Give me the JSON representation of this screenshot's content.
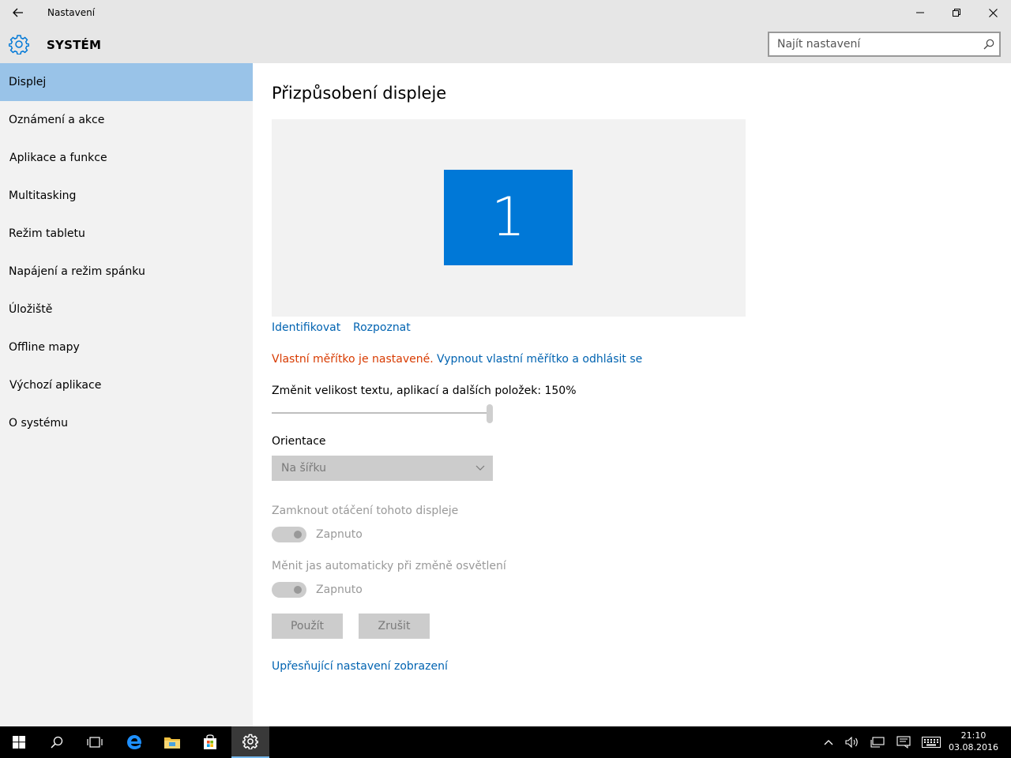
{
  "window": {
    "title": "Nastavení",
    "controls": [
      "minimize",
      "restore",
      "close"
    ]
  },
  "header": {
    "section_title": "SYSTÉM",
    "search_placeholder": "Najít nastavení"
  },
  "sidebar": {
    "items": [
      {
        "label": "Displej",
        "active": true
      },
      {
        "label": "Oznámení a akce"
      },
      {
        "label": "Aplikace a funkce"
      },
      {
        "label": "Multitasking"
      },
      {
        "label": "Režim tabletu"
      },
      {
        "label": "Napájení a režim spánku"
      },
      {
        "label": "Úložiště"
      },
      {
        "label": "Offline mapy"
      },
      {
        "label": "Výchozí aplikace"
      },
      {
        "label": "O systému"
      }
    ]
  },
  "main": {
    "title": "Přizpůsobení displeje",
    "monitor_number": "1",
    "identify_link": "Identifikovat",
    "detect_link": "Rozpoznat",
    "custom_scale_warning": "Vlastní měřítko je nastavené.",
    "disable_custom_scale_link": "Vypnout vlastní měřítko a odhlásit se",
    "scale_label": "Změnit velikost textu, aplikací a dalších položek: 150%",
    "scale_value_percent": 100,
    "orientation_label": "Orientace",
    "orientation_value": "Na šířku",
    "rotation_lock_label": "Zamknout otáčení tohoto displeje",
    "rotation_lock_state": "Zapnuto",
    "auto_brightness_label": "Měnit jas automaticky při změně osvětlení",
    "auto_brightness_state": "Zapnuto",
    "apply_button": "Použít",
    "cancel_button": "Zrušit",
    "advanced_link": "Upřesňující nastavení zobrazení"
  },
  "taskbar": {
    "time": "21:10",
    "date": "03.08.2016"
  },
  "colors": {
    "accent": "#0078d7",
    "sidebar_active": "#99c3e8",
    "link": "#0063b1",
    "warning": "#d83b01"
  }
}
